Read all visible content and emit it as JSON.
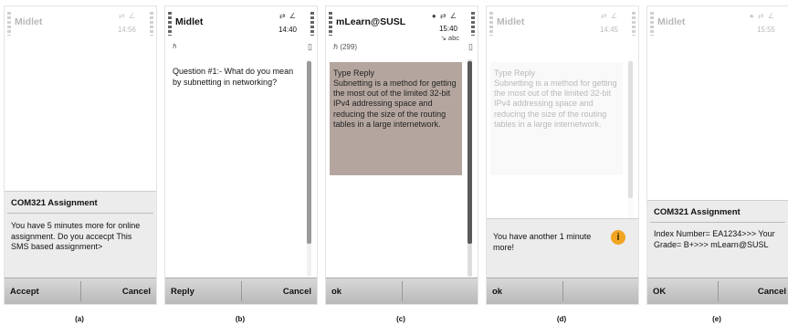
{
  "phone_a": {
    "app_title": "Midlet",
    "clock": "14:56",
    "dialog_title": "COM321 Assignment",
    "dialog_body": "You have 5 minutes more for online assignment. Do you accecpt This SMS based assignment>",
    "left_softkey": "Accept",
    "right_softkey": "Cancel",
    "caption": "(a)"
  },
  "phone_b": {
    "app_title": "Midlet",
    "clock": "14:40",
    "question": "Question #1:- What do you mean by subnetting in networking?",
    "left_softkey": "Reply",
    "right_softkey": "Cancel",
    "caption": "(b)"
  },
  "phone_c": {
    "app_title": "mLearn@SUSL",
    "count": "(299)",
    "clock": "15:40",
    "input_mode": "abc",
    "reply_label": "Type Reply",
    "reply_text": "Subnetting is a method for getting the most out of the limited 32-bit IPv4 addressing space and reducing the size of the routing tables in a large internetwork.",
    "left_softkey": "ok",
    "caption": "(c)"
  },
  "phone_d": {
    "app_title": "Midlet",
    "clock": "14:45",
    "reply_label": "Type Reply",
    "reply_text": "Subnetting is a method for getting the most out of the limited 32-bit IPv4 addressing space and reducing the size of the routing tables in a large internetwork.",
    "alert_text": "You have another 1 minute more!",
    "left_softkey": "ok",
    "caption": "(d)"
  },
  "phone_e": {
    "app_title": "Midlet",
    "clock": "15:55",
    "dialog_title": "COM321 Assignment",
    "dialog_body": "Index Number= EA1234>>> Your Grade= B+>>> mLearn@SUSL",
    "left_softkey": "OK",
    "right_softkey": "Cancel",
    "caption": "(e)"
  }
}
